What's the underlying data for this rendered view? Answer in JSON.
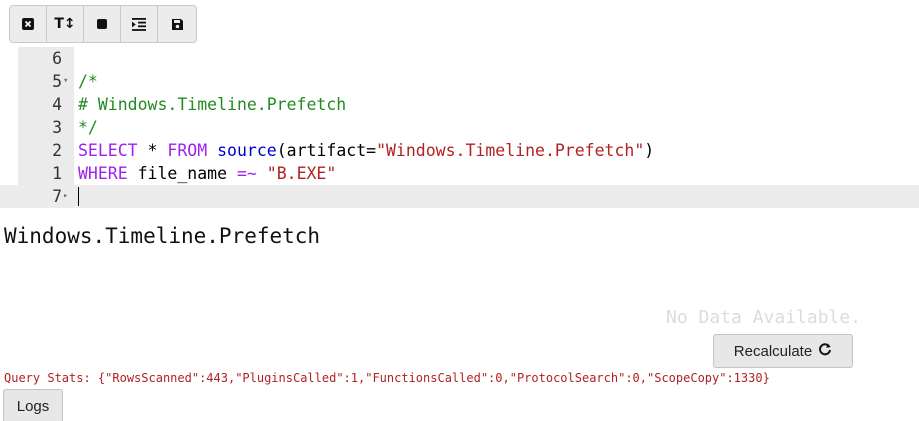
{
  "toolbar": {
    "buttons": [
      {
        "icon": "close-square-icon"
      },
      {
        "icon": "text-height-icon",
        "label": "T↕"
      },
      {
        "icon": "stop-icon"
      },
      {
        "icon": "indent-icon"
      },
      {
        "icon": "save-icon"
      }
    ]
  },
  "editor": {
    "lines": [
      {
        "number": "6",
        "fold": "",
        "text": ""
      },
      {
        "number": "5",
        "fold": "▾",
        "text": "/*"
      },
      {
        "number": "4",
        "fold": "",
        "text": "# Windows.Timeline.Prefetch"
      },
      {
        "number": "3",
        "fold": "",
        "text": "*/"
      },
      {
        "number": "2",
        "fold": "",
        "tokens": [
          "SELECT",
          " * ",
          "FROM",
          " ",
          "source",
          "(artifact=",
          "\"Windows.Timeline.Prefetch\"",
          ")"
        ]
      },
      {
        "number": "1",
        "fold": "",
        "tokens": [
          "WHERE",
          " file_name ",
          "=~",
          " ",
          "\"B.EXE\""
        ]
      },
      {
        "number": "7",
        "fold": "▸",
        "text": ""
      }
    ]
  },
  "result": {
    "title": "Windows.Timeline.Prefetch",
    "no_data": "No Data Available.",
    "recalculate_label": "Recalculate",
    "query_stats": "Query Stats: {\"RowsScanned\":443,\"PluginsCalled\":1,\"FunctionsCalled\":0,\"ProtocolSearch\":0,\"ScopeCopy\":1330}",
    "logs_label": "Logs"
  },
  "colors": {
    "comment": "#238b22",
    "keyword": "#a020f0",
    "function": "#0000cd",
    "string": "#b22222",
    "stats": "#b22222"
  }
}
